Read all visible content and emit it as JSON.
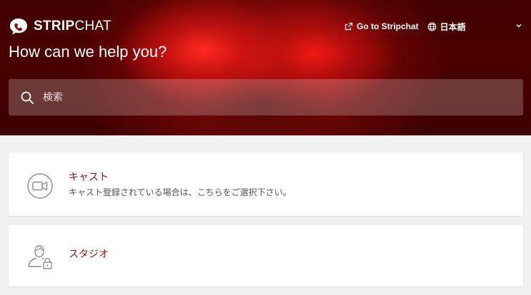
{
  "brand": {
    "name_strong": "STRIP",
    "name_light": "CHAT"
  },
  "header": {
    "go_link_label": "Go to Stripchat",
    "language_label": "日本語",
    "headline": "How can we help you?"
  },
  "search": {
    "placeholder": "検索",
    "value": ""
  },
  "categories": [
    {
      "title": "キャスト",
      "description": "キャスト登録されている場合は、こちらをご選択下さい。",
      "icon": "video-camera-icon"
    },
    {
      "title": "スタジオ",
      "description": "",
      "icon": "person-lock-icon"
    }
  ],
  "colors": {
    "hero_red": "#8a0606",
    "category_title": "#8a1b1b",
    "page_bg": "#f0f0f0",
    "icon_gray": "#8a8f96"
  }
}
